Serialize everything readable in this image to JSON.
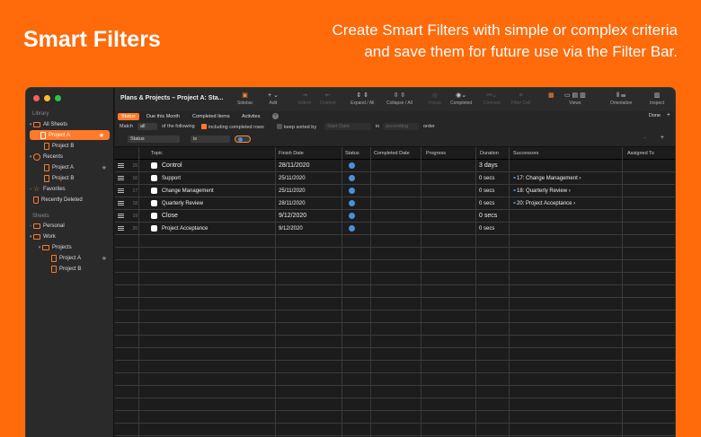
{
  "promo": {
    "title": "Smart Filters",
    "line1": "Create Smart Filters with simple or complex criteria",
    "line2": "and save them for future use via the Filter Bar."
  },
  "colors": {
    "accent": "#ff7a2a",
    "background": "#ff6a0a",
    "status_blue": "#4a90d9"
  },
  "sidebar": {
    "library_label": "Library",
    "sheets_label": "Sheets",
    "items": [
      {
        "label": "All Sheets",
        "icon": "folder-icon"
      },
      {
        "label": "Project A",
        "icon": "document-icon",
        "selected": true
      },
      {
        "label": "Project B",
        "icon": "document-icon"
      },
      {
        "label": "Recents",
        "icon": "clock-icon"
      },
      {
        "label": "Project A",
        "icon": "document-icon"
      },
      {
        "label": "Project B",
        "icon": "document-icon"
      },
      {
        "label": "Favorites",
        "icon": "star-icon"
      },
      {
        "label": "Recently Deleted",
        "icon": "trash-icon"
      },
      {
        "label": "Personal",
        "icon": "folder-icon"
      },
      {
        "label": "Work",
        "icon": "folder-icon"
      },
      {
        "label": "Projects",
        "icon": "folder-icon"
      },
      {
        "label": "Project A",
        "icon": "document-icon"
      },
      {
        "label": "Project B",
        "icon": "document-icon"
      }
    ]
  },
  "toolbar": {
    "doc_title": "Plans & Projects – Project A: Sta...",
    "sidebar": "Sidebar",
    "add": "Add",
    "indent": "Indent",
    "outdent": "Outdent",
    "expand": "Expand / All",
    "collapse": "Collapse / All",
    "focus": "Focus",
    "completed": "Completed",
    "connect": "Connect",
    "filter_cell": "Filter Cell",
    "views": "Views",
    "orientation": "Orientation",
    "inspect": "Inspect"
  },
  "filters": {
    "tabs": [
      "Status",
      "Due this Month",
      "Completed Items",
      "Activites"
    ],
    "done": "Done",
    "plus": "+"
  },
  "criteria": {
    "match": "Match",
    "match_value": "all",
    "of_following": "of the following",
    "including_completed": "including completed rows",
    "keep_sorted": "keep sorted by",
    "sort_field": "Start Date",
    "in": "in",
    "sort_order": "ascending",
    "order": "order",
    "field": "Status",
    "operator": "is",
    "minus": "−",
    "plus": "+"
  },
  "table": {
    "columns": [
      "Topic",
      "Finish Date",
      "Status",
      "Completed Date",
      "Progress",
      "Duration",
      "Successors",
      "Assigned To"
    ],
    "rows": [
      {
        "num": "15",
        "topic": "Control",
        "finish": "28/11/2020",
        "duration": "3 days",
        "successors": "",
        "big": true
      },
      {
        "num": "16",
        "topic": "Support",
        "finish": "25/11/2020",
        "duration": "0 secs",
        "successors": "17: Change Management ›",
        "big": false
      },
      {
        "num": "17",
        "topic": "Change Management",
        "finish": "25/11/2020",
        "duration": "0 secs",
        "successors": "18: Quarterly Review ›",
        "big": false
      },
      {
        "num": "18",
        "topic": "Quarterly Review",
        "finish": "28/11/2020",
        "duration": "0 secs",
        "successors": "20: Project Acceptance ›",
        "big": false
      },
      {
        "num": "19",
        "topic": "Close",
        "finish": "9/12/2020",
        "duration": "0 secs",
        "successors": "",
        "big": true
      },
      {
        "num": "20",
        "topic": "Project Acceptance",
        "finish": "9/12/2020",
        "duration": "0 secs",
        "successors": "",
        "big": false
      }
    ]
  }
}
